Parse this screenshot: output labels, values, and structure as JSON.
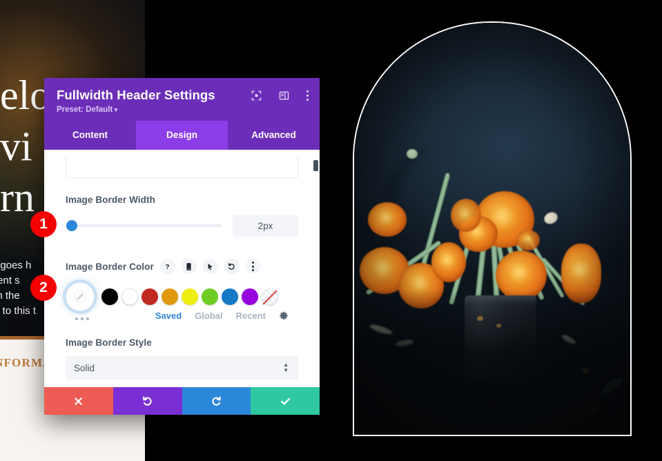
{
  "background_site": {
    "headline_lines": [
      "elo",
      "vi",
      "rn"
    ],
    "paragraph_lines": [
      "t goes h",
      "tent s",
      "in the",
      "s to this t"
    ],
    "lower_text": "NFORMA"
  },
  "modal": {
    "title": "Fullwidth Header Settings",
    "preset": "Preset: Default",
    "preset_caret": "▾",
    "header_icons": [
      {
        "name": "focus-frame-icon",
        "glyph": "⊡"
      },
      {
        "name": "layout-panel-icon",
        "glyph": "▥"
      },
      {
        "name": "more-options-icon",
        "glyph": "⋮"
      }
    ],
    "tabs": [
      {
        "label": "Content",
        "active": false
      },
      {
        "label": "Design",
        "active": true
      },
      {
        "label": "Advanced",
        "active": false
      }
    ],
    "fields": {
      "border_width": {
        "label": "Image Border Width",
        "value": "2px",
        "slider_percent": 2
      },
      "border_color": {
        "label": "Image Border Color",
        "control_icons": [
          {
            "name": "help-icon",
            "glyph": "?"
          },
          {
            "name": "responsive-mobile-icon",
            "glyph": "▯"
          },
          {
            "name": "hover-cursor-icon",
            "glyph": "➤"
          },
          {
            "name": "reset-icon",
            "glyph": "↺"
          },
          {
            "name": "more-options-icon",
            "glyph": "⋮"
          }
        ],
        "eyedropper_name": "eyedropper-icon",
        "swatches": [
          {
            "name": "swatch-black",
            "hex": "#000000"
          },
          {
            "name": "swatch-white",
            "hex": "#ffffff"
          },
          {
            "name": "swatch-red",
            "hex": "#c0291f"
          },
          {
            "name": "swatch-orange",
            "hex": "#e09a12"
          },
          {
            "name": "swatch-yellow",
            "hex": "#eeee11"
          },
          {
            "name": "swatch-green",
            "hex": "#6fcc24"
          },
          {
            "name": "swatch-blue",
            "hex": "#1579c6"
          },
          {
            "name": "swatch-purple",
            "hex": "#9500dd"
          },
          {
            "name": "swatch-none",
            "hex": "transparent"
          }
        ],
        "palette_tabs": [
          {
            "label": "Saved",
            "active": true
          },
          {
            "label": "Global",
            "active": false
          },
          {
            "label": "Recent",
            "active": false
          }
        ],
        "settings_icon": "gear-icon"
      },
      "border_style": {
        "label": "Image Border Style",
        "value": "Solid"
      }
    },
    "actions": [
      {
        "name": "cancel-button",
        "glyph": "✖",
        "color": "#ec5c54"
      },
      {
        "name": "undo-button",
        "glyph": "↺",
        "color": "#7a2fd4"
      },
      {
        "name": "redo-button",
        "glyph": "↻",
        "color": "#2b87da"
      },
      {
        "name": "save-button",
        "glyph": "✔",
        "color": "#2fc8a0"
      }
    ]
  },
  "callouts": [
    {
      "name": "callout-badge-1",
      "number": "1"
    },
    {
      "name": "callout-badge-2",
      "number": "2"
    }
  ],
  "preview_image": {
    "alt": "orange-ranunculus-flowers-in-dark-vase",
    "border_color": "#ffffff",
    "border_width": "2px",
    "shape": "arch"
  }
}
